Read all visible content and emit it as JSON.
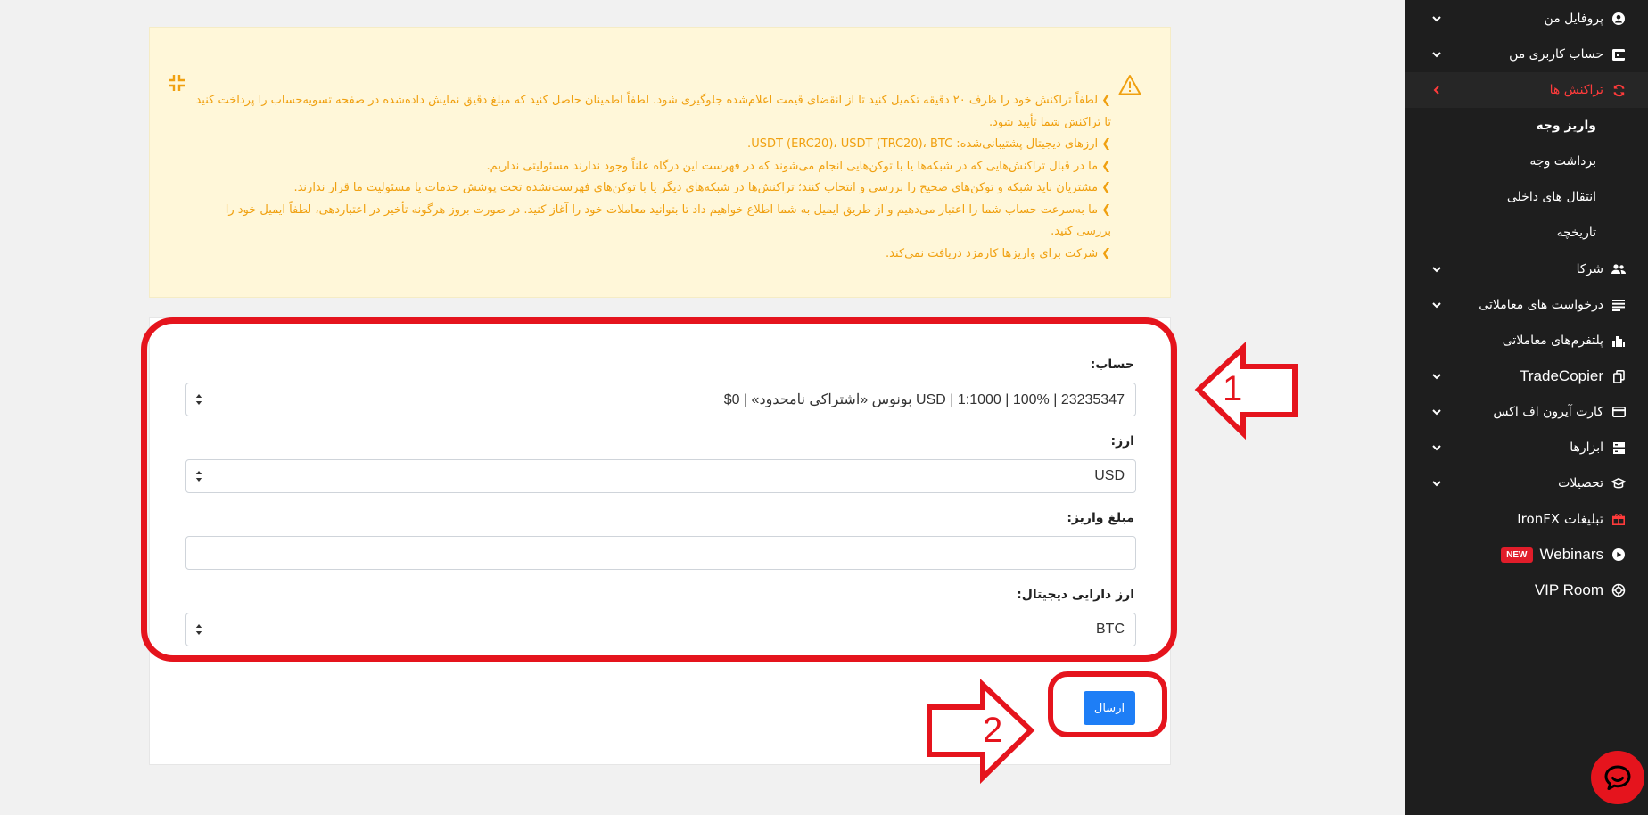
{
  "sidebar": {
    "items": [
      {
        "label": "پروفایل من",
        "icon": "user-circle-icon"
      },
      {
        "label": "حساب کاربری من",
        "icon": "wallet-icon"
      },
      {
        "label": "تراکنش ها",
        "icon": "refresh-icon"
      },
      {
        "label": "شرکا",
        "icon": "users-icon"
      },
      {
        "label": "درخواست های معاملاتی",
        "icon": "list-icon"
      },
      {
        "label": "پلتفرم‌های معاملاتی",
        "icon": "bar-chart-icon"
      },
      {
        "label": "TradeCopier",
        "icon": "copy-icon"
      },
      {
        "label": "کارت آیرون اف اکس",
        "icon": "credit-card-icon"
      },
      {
        "label": "ابزارها",
        "icon": "tools-icon"
      },
      {
        "label": "تحصیلات",
        "icon": "graduation-cap-icon"
      },
      {
        "label": "تبلیغات IronFX",
        "icon": "gift-icon"
      },
      {
        "label": "Webinars",
        "icon": "play-icon",
        "badge": "NEW"
      },
      {
        "label": "VIP Room",
        "icon": "vip-icon"
      }
    ],
    "sub_items": [
      {
        "label": "واریز وجه"
      },
      {
        "label": "برداشت وجه"
      },
      {
        "label": "انتقال های داخلی"
      },
      {
        "label": "تاریخچه"
      }
    ]
  },
  "warning": {
    "lines": [
      "لطفاً تراکنش خود را ظرف ۲۰ دقیقه تکمیل کنید تا از انقضای قیمت اعلام‌شده جلوگیری شود. لطفاً اطمینان حاصل کنید که مبلغ دقیق نمایش داده‌شده در صفحه تسویه‌حساب را پرداخت کنید تا تراکنش شما تأیید شود.",
      "ارزهای دیجیتال پشتیبانی‌شده: USDT (ERC20)، USDT (TRC20)، BTC.",
      "ما در قبال تراکنش‌هایی که در شبکه‌ها یا با توکن‌هایی انجام می‌شوند که در فهرست این درگاه علناً وجود ندارند مسئولیتی نداریم.",
      "مشتریان باید شبکه و توکن‌های صحیح را بررسی و انتخاب کنند؛ تراکنش‌ها در شبکه‌های دیگر یا با توکن‌های فهرست‌نشده تحت پوشش خدمات یا مسئولیت ما قرار ندارند.",
      "ما به‌سرعت حساب شما را اعتبار می‌دهیم و از طریق ایمیل به شما اطلاع خواهیم داد تا بتوانید معاملات خود را آغاز کنید. در صورت بروز هرگونه تأخیر در اعتباردهی، لطفاً ایمیل خود را بررسی کنید.",
      "شرکت برای واریزها کارمزد دریافت نمی‌کند."
    ]
  },
  "form": {
    "account_label": "حساب:",
    "account_value": "23235347 | 100% | 1:1000 | USD بونوس «اشتراکی نامحدود» | 0$",
    "currency_label": "ارز:",
    "currency_value": "USD",
    "amount_label": "مبلغ واریز:",
    "amount_value": "",
    "crypto_label": "ارز دارایی دیجیتال:",
    "crypto_value": "BTC",
    "submit_label": "ارسال"
  },
  "annotations": {
    "step1": "1",
    "step2": "2"
  },
  "colors": {
    "accent_red": "#e5141d",
    "warning_text": "#f0a010",
    "primary_blue": "#1e7ef6",
    "sidebar_bg": "#1e1e1e"
  }
}
